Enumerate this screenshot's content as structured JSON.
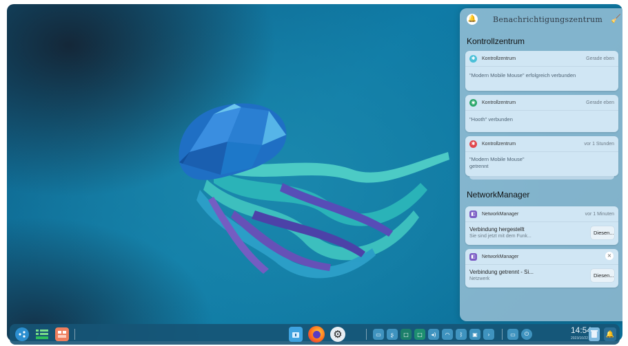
{
  "notification_center": {
    "title": "Benachrichtigungszentrum",
    "groups": [
      {
        "name": "Kontrollzentrum",
        "notifications": [
          {
            "app": "Kontrollzentrum",
            "time": "Gerade eben",
            "message": "\"Modern Mobile Mouse\" erfolgreich verbunden",
            "icon": "bluetooth-icon",
            "icon_color": "#4cc0d8"
          },
          {
            "app": "Kontrollzentrum",
            "time": "Gerade eben",
            "message": "\"Hooth\" verbunden",
            "icon": "wifi-icon",
            "icon_color": "#2ca86b"
          },
          {
            "app": "Kontrollzentrum",
            "time": "vor 1 Stunden",
            "message_line1": "\"Modern Mobile Mouse\"",
            "message_line2": "getrennt",
            "icon": "bluetooth-off-icon",
            "icon_color": "#e0474c"
          }
        ]
      },
      {
        "name": "NetworkManager",
        "notifications": [
          {
            "app": "NetworkManager",
            "time": "vor 1 Minuten",
            "title": "Verbindung hergestellt",
            "subtitle": "Sie sind jetzt mit dem Funk...",
            "action": "Diesen...",
            "icon": "network-icon",
            "icon_color": "#7a5bc4"
          },
          {
            "app": "NetworkManager",
            "title": "Verbindung getrennt - Si...",
            "subtitle": "Netzwerk",
            "action": "Diesen...",
            "icon": "network-icon",
            "icon_color": "#7a5bc4"
          }
        ]
      }
    ]
  },
  "dock": {
    "clock": {
      "time": "14:54",
      "date": "2023/10/22"
    },
    "launcher_icon": "launcher-icon",
    "apps": [
      "file-manager-icon",
      "firefox-icon",
      "settings-icon"
    ],
    "tray_icons": [
      "screen-icon",
      "app-tray-icon",
      "green-icon",
      "green-icon-2",
      "volume-icon",
      "wifi-icon",
      "bluetooth-icon",
      "display-icon",
      "chevron-right-icon",
      "window-icon",
      "power-icon"
    ],
    "accent": "#3f93bf"
  }
}
